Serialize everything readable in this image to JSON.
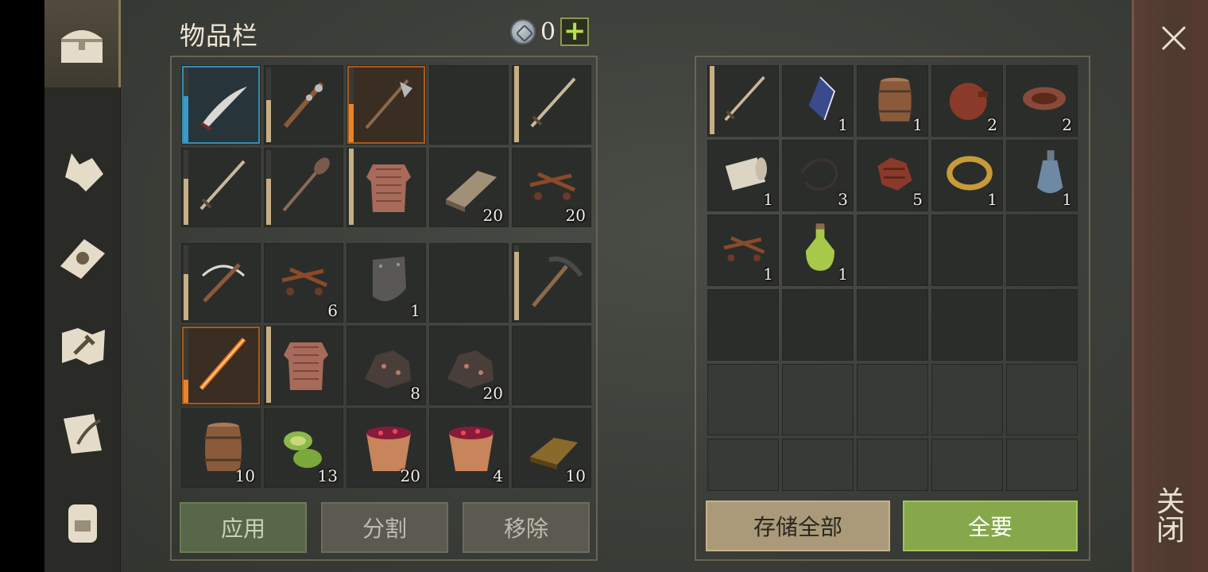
{
  "inventory": {
    "title": "物品栏",
    "currency": {
      "value": "0",
      "icon": "coin-icon",
      "add_label": "+"
    },
    "buttons": {
      "apply": "应用",
      "split": "分割",
      "remove": "移除"
    },
    "top_slots": [
      {
        "icon": "curved-sword-icon",
        "count": "",
        "durability": 0.6,
        "rarity": "rare"
      },
      {
        "icon": "spiked-club-icon",
        "count": "",
        "durability": 0.55
      },
      {
        "icon": "halberd-icon",
        "count": "",
        "durability": 0.5,
        "rarity": "epic"
      },
      {
        "icon": "",
        "count": ""
      },
      {
        "icon": "sword-icon",
        "count": "",
        "durability": 1.0
      },
      {
        "icon": "sword-icon",
        "count": "",
        "durability": 0.6
      },
      {
        "icon": "mace-icon",
        "count": "",
        "durability": 0.6
      },
      {
        "icon": "chainmail-icon",
        "count": "",
        "durability": 1.0
      },
      {
        "icon": "wood-plank-icon",
        "count": "20"
      },
      {
        "icon": "nails-icon",
        "count": "20"
      }
    ],
    "bottom_slots": [
      {
        "icon": "crossbow-icon",
        "count": "",
        "durability": 0.6
      },
      {
        "icon": "nails-icon",
        "count": "6"
      },
      {
        "icon": "shield-plate-icon",
        "count": "1"
      },
      {
        "icon": "",
        "count": ""
      },
      {
        "icon": "pickaxe-icon",
        "count": "",
        "durability": 0.9
      },
      {
        "icon": "flame-sword-icon",
        "count": "",
        "durability": 0.3,
        "rarity": "epic"
      },
      {
        "icon": "chainmail-icon",
        "count": "",
        "durability": 1.0
      },
      {
        "icon": "ore-icon",
        "count": "8"
      },
      {
        "icon": "ore-icon",
        "count": "20"
      },
      {
        "icon": "",
        "count": ""
      },
      {
        "icon": "barrel-icon",
        "count": "10"
      },
      {
        "icon": "cactus-slices-icon",
        "count": "13"
      },
      {
        "icon": "berry-bucket-icon",
        "count": "20"
      },
      {
        "icon": "berry-bucket-icon",
        "count": "4"
      },
      {
        "icon": "ingot-icon",
        "count": "10"
      }
    ]
  },
  "storage": {
    "buttons": {
      "store_all": "存储全部",
      "take_all": "全要"
    },
    "slots": [
      {
        "icon": "sword-icon",
        "count": "",
        "durability": 1.0
      },
      {
        "icon": "crystal-icon",
        "count": "1"
      },
      {
        "icon": "barrel-icon",
        "count": "1"
      },
      {
        "icon": "waterskin-icon",
        "count": "2"
      },
      {
        "icon": "leather-icon",
        "count": "2"
      },
      {
        "icon": "cloth-roll-icon",
        "count": "1"
      },
      {
        "icon": "rope-icon",
        "count": "3"
      },
      {
        "icon": "scrap-icon",
        "count": "5"
      },
      {
        "icon": "ring-icon",
        "count": "1"
      },
      {
        "icon": "flask-icon",
        "count": "1"
      },
      {
        "icon": "nails-icon",
        "count": "1"
      },
      {
        "icon": "potion-icon",
        "count": "1"
      },
      {
        "icon": "",
        "count": ""
      },
      {
        "icon": "",
        "count": ""
      },
      {
        "icon": "",
        "count": ""
      },
      {
        "icon": "",
        "count": ""
      },
      {
        "icon": "",
        "count": ""
      },
      {
        "icon": "",
        "count": ""
      },
      {
        "icon": "",
        "count": ""
      },
      {
        "icon": "",
        "count": ""
      },
      {
        "icon": "",
        "count": "",
        "dim": true
      },
      {
        "icon": "",
        "count": "",
        "dim": true
      },
      {
        "icon": "",
        "count": "",
        "dim": true
      },
      {
        "icon": "",
        "count": "",
        "dim": true
      },
      {
        "icon": "",
        "count": "",
        "dim": true
      },
      {
        "icon": "",
        "count": "",
        "dim": true
      },
      {
        "icon": "",
        "count": "",
        "dim": true
      },
      {
        "icon": "",
        "count": "",
        "dim": true
      },
      {
        "icon": "",
        "count": "",
        "dim": true
      },
      {
        "icon": "",
        "count": "",
        "dim": true
      }
    ]
  },
  "sidebar": {
    "tabs": [
      {
        "icon": "chest-icon",
        "active": true
      },
      {
        "icon": "wolf-icon"
      },
      {
        "icon": "sun-book-icon"
      },
      {
        "icon": "map-hammer-icon"
      },
      {
        "icon": "scroll-quill-icon"
      },
      {
        "icon": "backpack-icon"
      }
    ]
  },
  "close": {
    "label": "关闭",
    "icon": "close-icon"
  },
  "colors": {
    "take_all_green": "#86a84a",
    "store_tan": "#aa9a7a",
    "durability": "#c7ae84",
    "rare": "#3a8bb0",
    "epic": "#a85a1c"
  }
}
